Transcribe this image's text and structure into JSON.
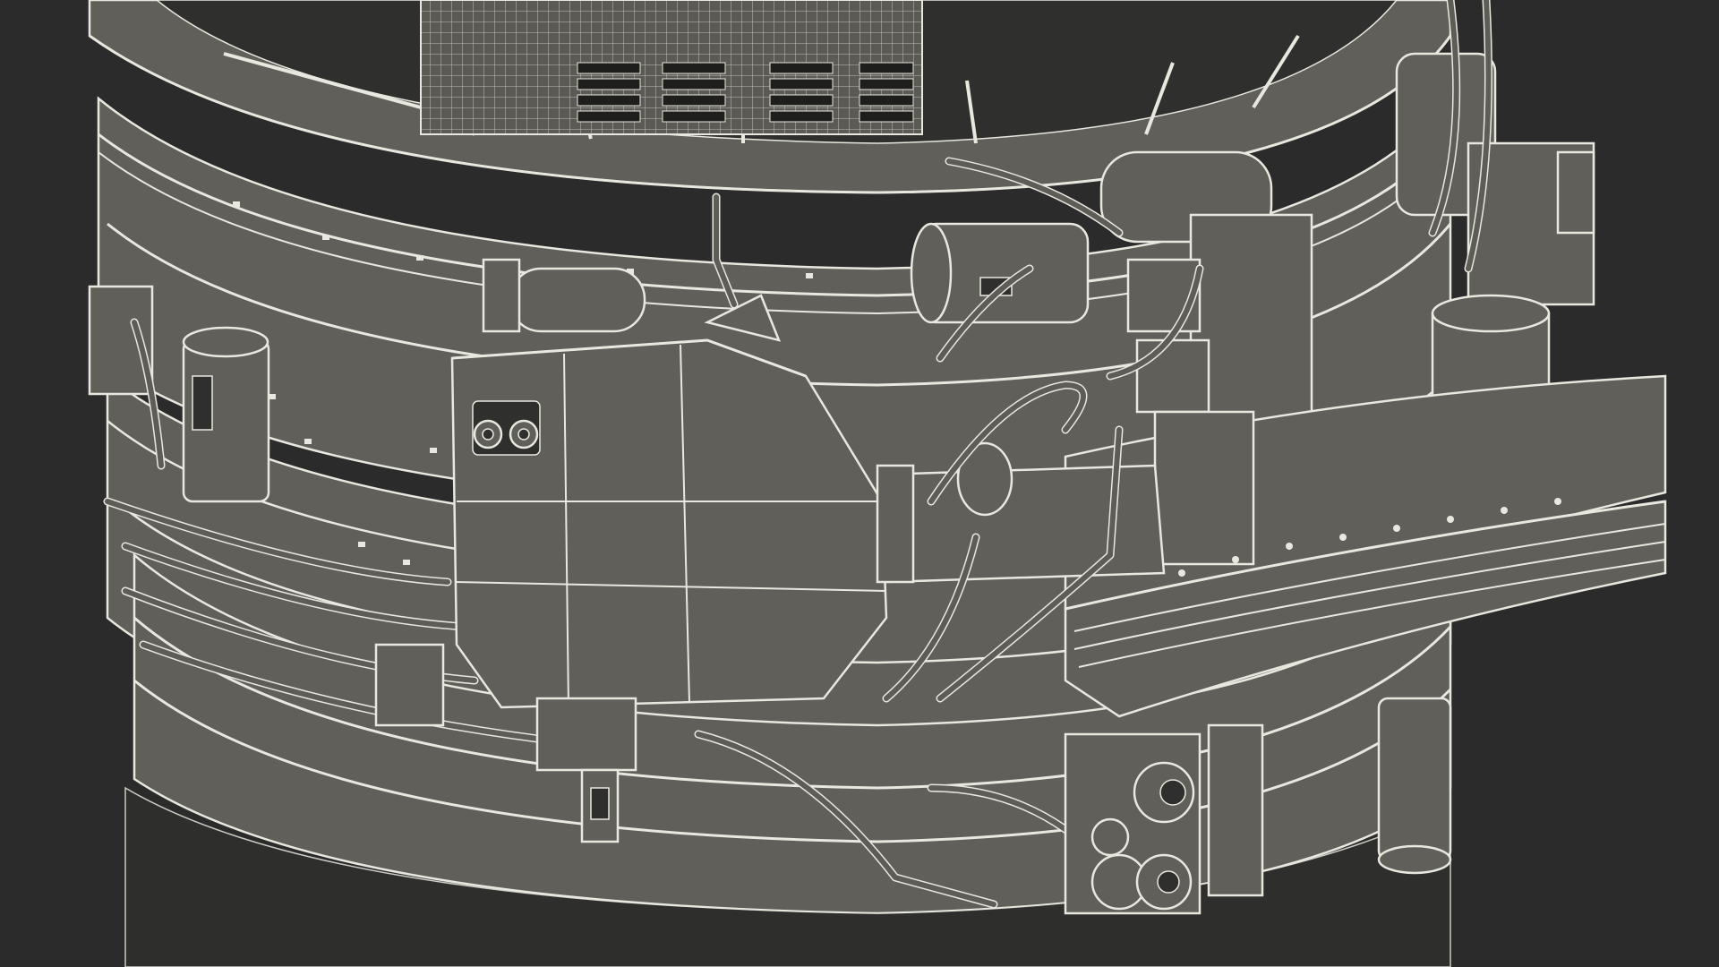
{
  "scene": {
    "icon": "wireframe-machinery-render-icon",
    "colors": {
      "background": "#2b2b2b",
      "mesh_fill": "#605f59",
      "wire": "#e9e8df",
      "shadow": "#2f2f2d"
    }
  }
}
